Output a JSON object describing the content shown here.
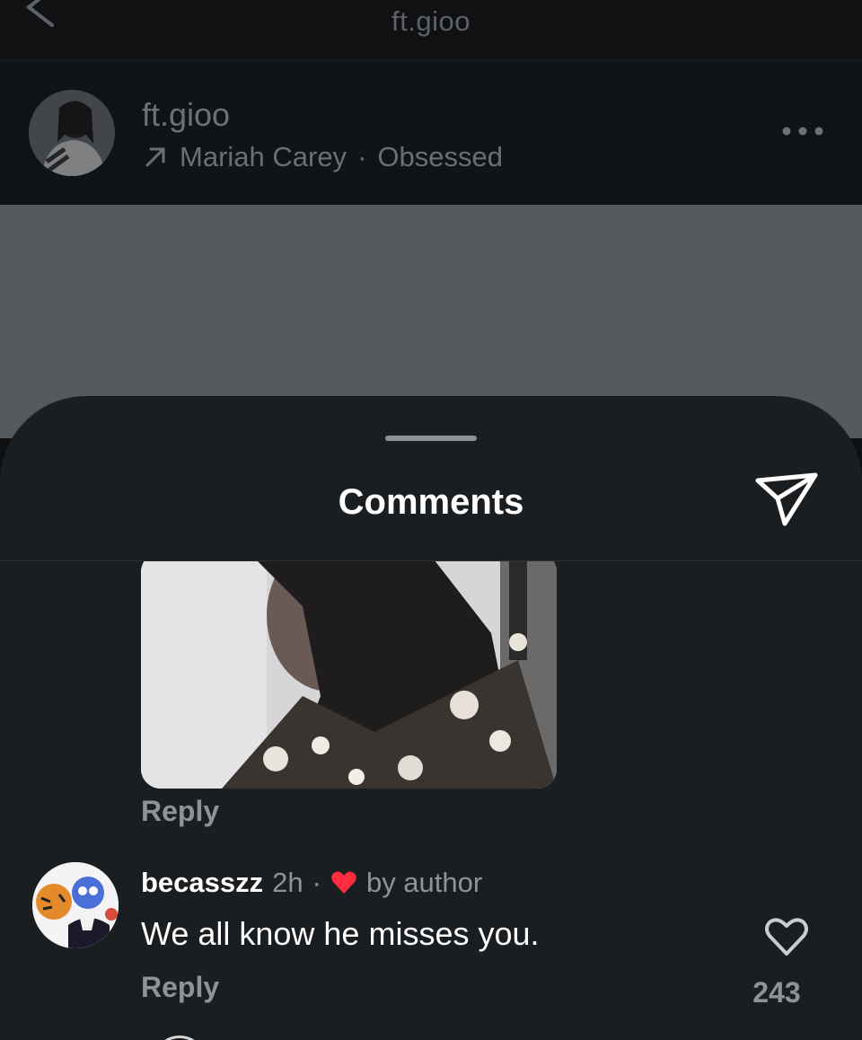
{
  "topbar": {
    "title": "ft.gioo"
  },
  "post": {
    "username": "ft.gioo",
    "music": {
      "artist": "Mariah Carey",
      "separator": "·",
      "song": "Obsessed"
    }
  },
  "sheet": {
    "title": "Comments"
  },
  "comments": [
    {
      "reply_label": "Reply"
    },
    {
      "username": "becasszz",
      "time": "2h",
      "separator": "·",
      "liked_by": "by author",
      "text": "We all know he misses you.",
      "reply_label": "Reply",
      "like_count": "243"
    }
  ],
  "icons": {
    "back": "chevron-left-icon",
    "music": "arrow-up-right-icon",
    "more": "ellipsis-icon",
    "share": "paper-plane-icon",
    "author_heart": "heart-filled-icon",
    "like": "heart-outline-icon"
  },
  "colors": {
    "author_heart": "#ff2d3d",
    "secondary_text": "#8f9398",
    "sheet_bg": "#1b1e21"
  }
}
